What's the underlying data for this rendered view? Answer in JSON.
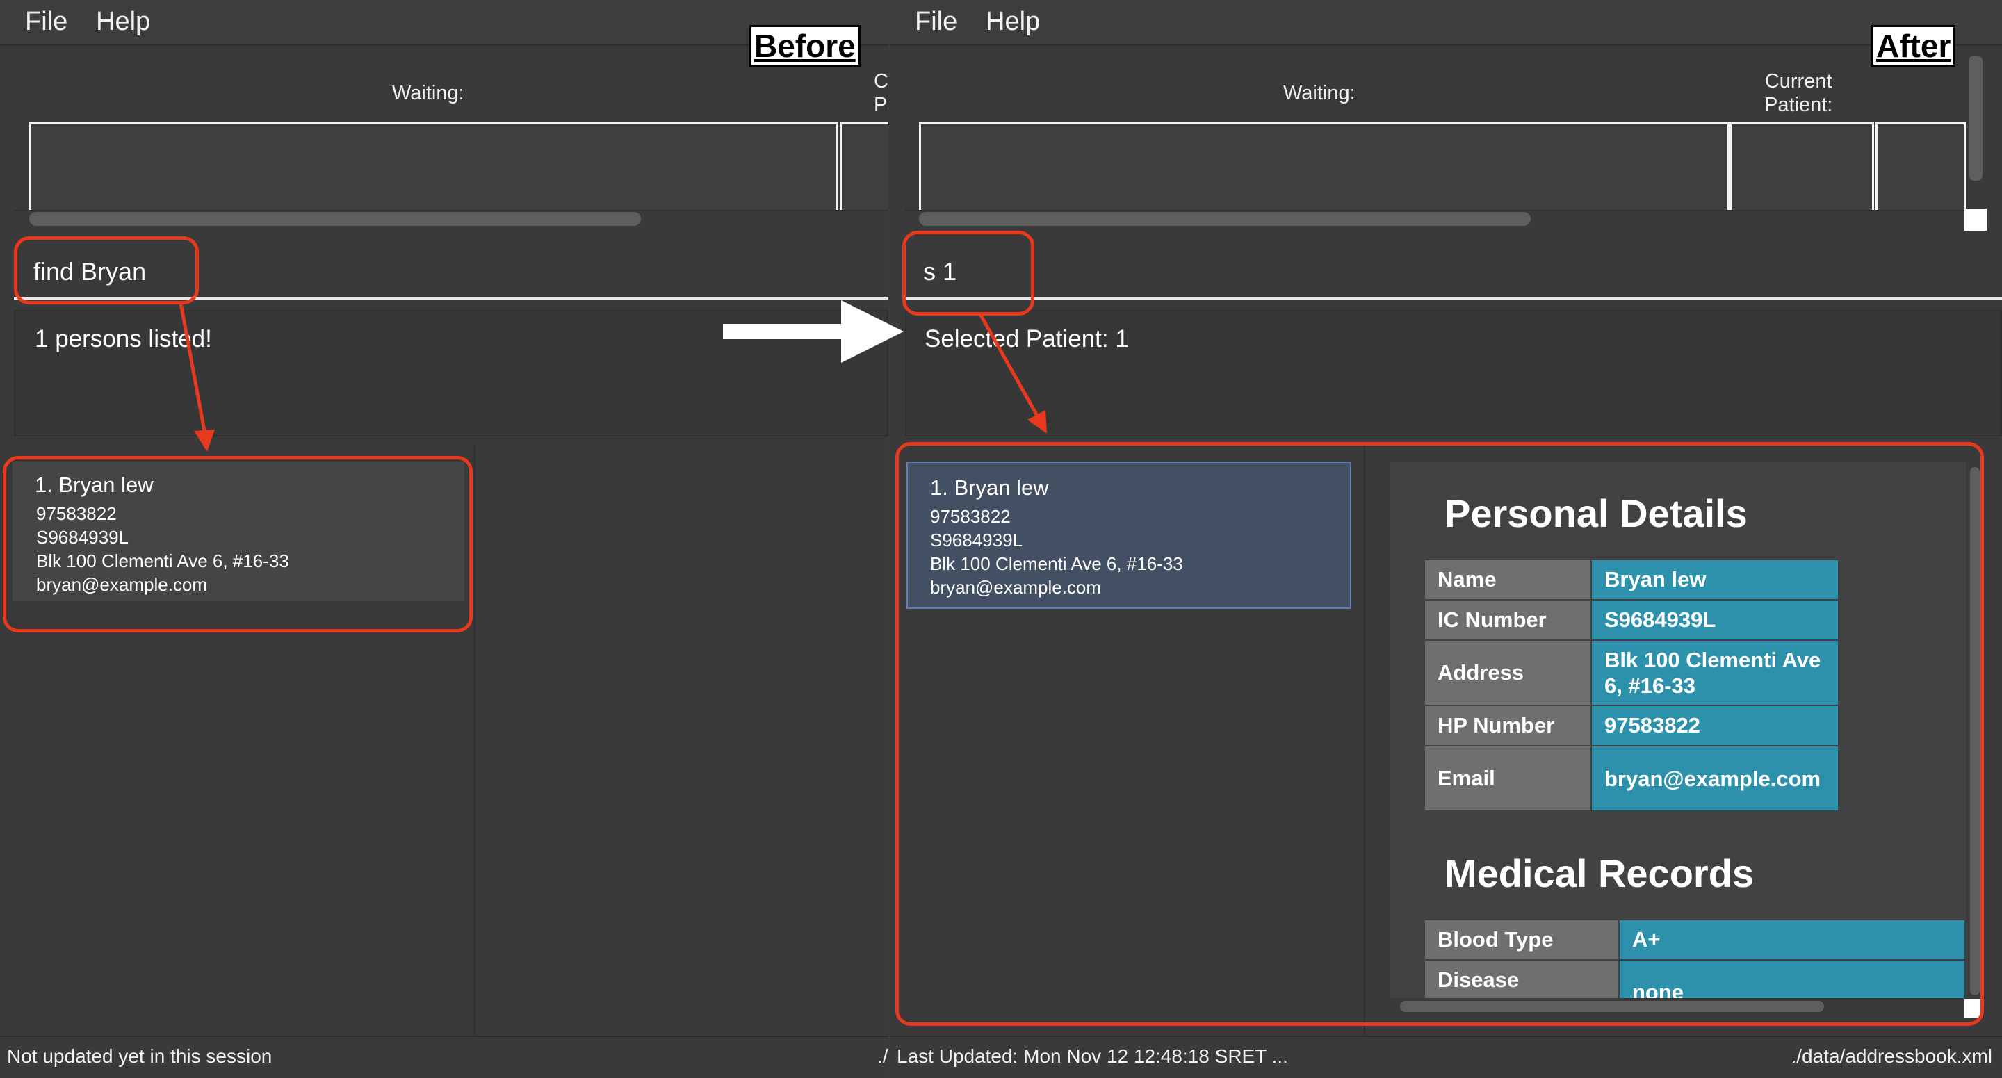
{
  "before": {
    "menu": [
      "File",
      "Help"
    ],
    "tag": "Before",
    "queue": {
      "waiting_label": "Waiting:",
      "current_label_line1": "C",
      "current_label_line2": "Pa"
    },
    "command": "find Bryan",
    "result": "1 persons listed!",
    "card": {
      "name": "1.  Bryan lew",
      "phone": "97583822",
      "ic": "S9684939L",
      "address": "Blk 100 Clementi Ave 6, #16-33",
      "email": "bryan@example.com"
    },
    "status_left": "Not updated yet in this session",
    "status_right": "./"
  },
  "after": {
    "menu": [
      "File",
      "Help"
    ],
    "tag": "After",
    "queue": {
      "waiting_label": "Waiting:",
      "current_label_line1": "Current",
      "current_label_line2": "Patient:"
    },
    "command": "s 1",
    "result": "Selected Patient: 1",
    "card": {
      "name": "1.  Bryan lew",
      "phone": "97583822",
      "ic": "S9684939L",
      "address": "Blk 100 Clementi Ave 6, #16-33",
      "email": "bryan@example.com"
    },
    "personal_heading": "Personal Details",
    "personal": [
      {
        "key": "Name",
        "value": "Bryan lew"
      },
      {
        "key": "IC Number",
        "value": "S9684939L"
      },
      {
        "key": "Address",
        "value": "Blk 100 Clementi Ave 6, #16-33"
      },
      {
        "key": "HP Number",
        "value": "97583822"
      },
      {
        "key": "Email",
        "value": "bryan@example.com"
      }
    ],
    "medical_heading": "Medical Records",
    "medical": [
      {
        "key": "Blood Type",
        "value": "A+"
      },
      {
        "key": "Disease",
        "value": "none"
      }
    ],
    "status_left": "Last Updated: Mon Nov 12 12:48:18 SRET ...",
    "status_right": "./data/addressbook.xml"
  },
  "colors": {
    "annotation_red": "#e8391e",
    "table_value": "#2e91ac",
    "table_key": "#6f6f6f",
    "selected_card": "#434f62"
  }
}
